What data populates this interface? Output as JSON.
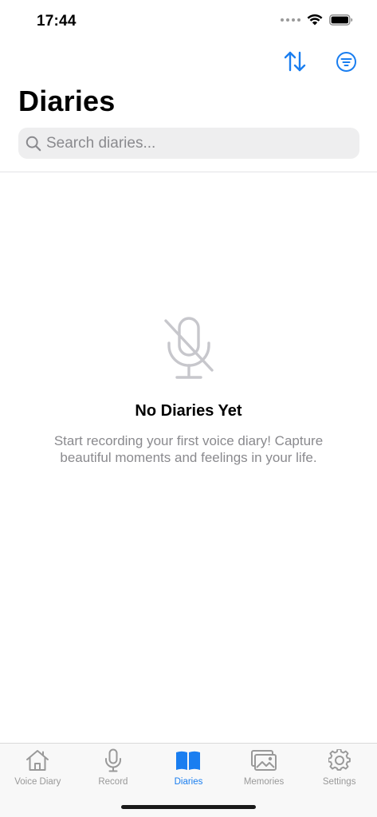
{
  "status_bar": {
    "time": "17:44"
  },
  "nav": {
    "sort_icon": "sort-arrows-icon",
    "filter_icon": "filter-lines-icon"
  },
  "page": {
    "title": "Diaries"
  },
  "search": {
    "placeholder": "Search diaries...",
    "value": ""
  },
  "empty_state": {
    "icon": "mic-slash-icon",
    "title": "No Diaries Yet",
    "message": "Start recording your first voice diary! Capture beautiful moments and feelings in your life."
  },
  "tabs": [
    {
      "label": "Voice Diary",
      "icon": "house-icon",
      "active": false
    },
    {
      "label": "Record",
      "icon": "mic-icon",
      "active": false
    },
    {
      "label": "Diaries",
      "icon": "book-icon",
      "active": true
    },
    {
      "label": "Memories",
      "icon": "photos-icon",
      "active": false
    },
    {
      "label": "Settings",
      "icon": "gear-icon",
      "active": false
    }
  ],
  "colors": {
    "accent": "#1a7ef0",
    "inactive": "#999999",
    "secondary_text": "#8a8a8e",
    "search_bg": "#eeeeef"
  }
}
